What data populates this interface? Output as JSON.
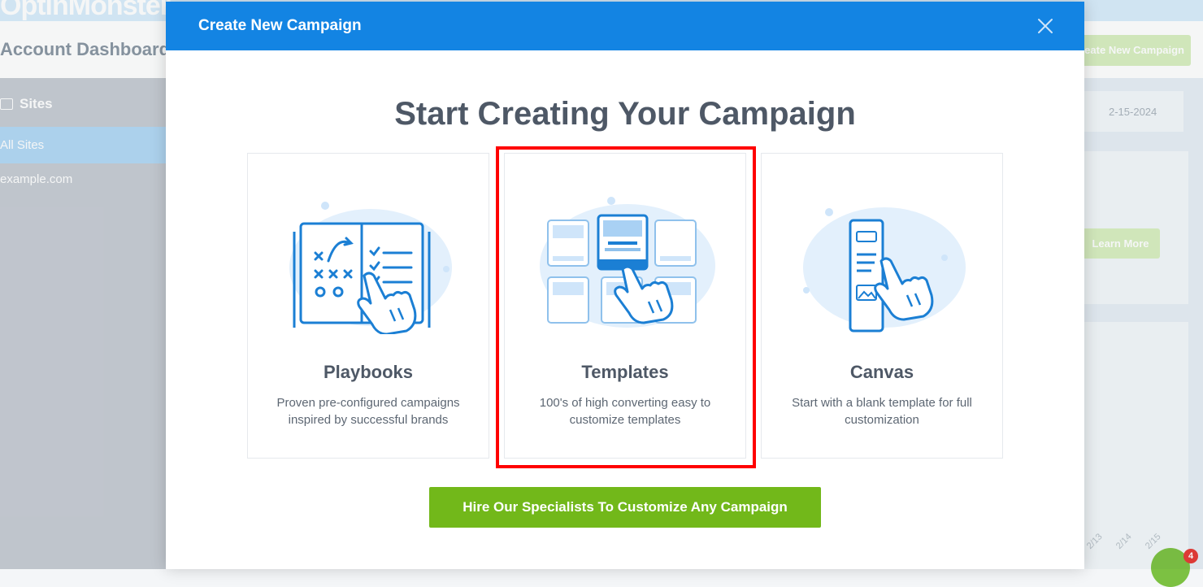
{
  "background": {
    "logo": "OptinMonster",
    "title": "Account Dashboard",
    "sidebar": {
      "heading": "Sites",
      "items": [
        {
          "label": "All Sites"
        },
        {
          "label": "example.com"
        }
      ]
    },
    "create_button": "Create New Campaign",
    "date_range": "2-15-2024",
    "learn_more": "Learn More",
    "chart_ticks": [
      "2/13",
      "2/14",
      "2/15"
    ],
    "chat_badge": "4"
  },
  "modal": {
    "title": "Create New Campaign",
    "close_icon": "close-icon",
    "heading": "Start Creating Your Campaign",
    "cards": [
      {
        "title": "Playbooks",
        "description": "Proven pre-configured campaigns inspired by successful brands",
        "icon": "playbook-icon"
      },
      {
        "title": "Templates",
        "description": "100's of high converting easy to customize templates",
        "icon": "templates-icon"
      },
      {
        "title": "Canvas",
        "description": "Start with a blank template for full customization",
        "icon": "canvas-icon"
      }
    ],
    "cta": "Hire Our Specialists To Customize Any Campaign"
  },
  "colors": {
    "header_blue": "#1384e3",
    "cta_green": "#72b81a",
    "highlight_red": "#ff0000",
    "text_dark": "#4e5866"
  }
}
